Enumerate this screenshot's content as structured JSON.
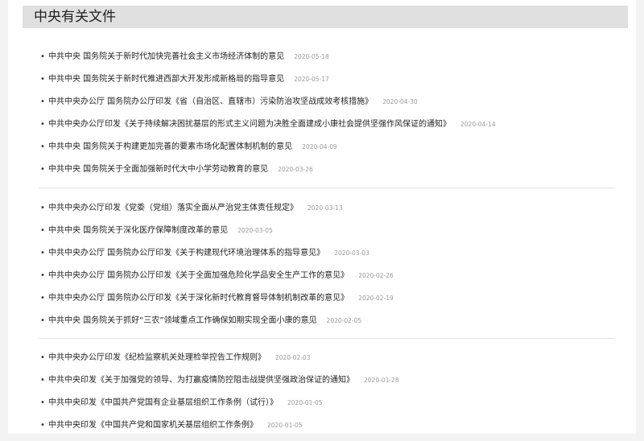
{
  "header": {
    "title": "中央有关文件"
  },
  "groups": [
    {
      "items": [
        {
          "title": "中共中央 国务院关于新时代加快完善社会主义市场经济体制的意见",
          "date": "2020-05-18"
        },
        {
          "title": "中共中央 国务院关于新时代推进西部大开发形成新格局的指导意见",
          "date": "2020-05-17"
        },
        {
          "title": "中共中央办公厅 国务院办公厅印发《省（自治区、直辖市）污染防治攻坚战成效考核措施》",
          "date": "2020-04-30"
        },
        {
          "title": "中共中央办公厅印发《关于持续解决困扰基层的形式主义问题为决胜全面建成小康社会提供坚强作风保证的通知》",
          "date": "2020-04-14"
        },
        {
          "title": "中共中央 国务院关于构建更加完善的要素市场化配置体制机制的意见",
          "date": "2020-04-09"
        },
        {
          "title": "中共中央 国务院关于全面加强新时代大中小学劳动教育的意见",
          "date": "2020-03-26"
        }
      ]
    },
    {
      "items": [
        {
          "title": "中共中央办公厅印发《党委（党组）落实全面从严治党主体责任规定》",
          "date": "2020-03-13"
        },
        {
          "title": "中共中央 国务院关于深化医疗保障制度改革的意见",
          "date": "2020-03-05"
        },
        {
          "title": "中共中央办公厅 国务院办公厅印发《关于构建现代环境治理体系的指导意见》",
          "date": "2020-03-03"
        },
        {
          "title": "中共中央办公厅 国务院办公厅印发《关于全面加强危险化学品安全生产工作的意见》",
          "date": "2020-02-26"
        },
        {
          "title": "中共中央办公厅 国务院办公厅印发《关于深化新时代教育督导体制机制改革的意见》",
          "date": "2020-02-19"
        },
        {
          "title": "中共中央 国务院关于抓好“三农”领域重点工作确保如期实现全面小康的意见",
          "date": "2020-02-05"
        }
      ]
    },
    {
      "items": [
        {
          "title": "中共中央办公厅印发《纪检监察机关处理检举控告工作规则》",
          "date": "2020-02-03"
        },
        {
          "title": "中共中央印发《关于加强党的领导、为打赢疫情防控阻击战提供坚强政治保证的通知》",
          "date": "2020-01-28"
        },
        {
          "title": "中共中央印发《中国共产党国有企业基层组织工作条例（试行）》",
          "date": "2020-01-05"
        },
        {
          "title": "中共中央印发《中国共产党和国家机关基层组织工作条例》",
          "date": "2020-01-05"
        }
      ]
    }
  ]
}
